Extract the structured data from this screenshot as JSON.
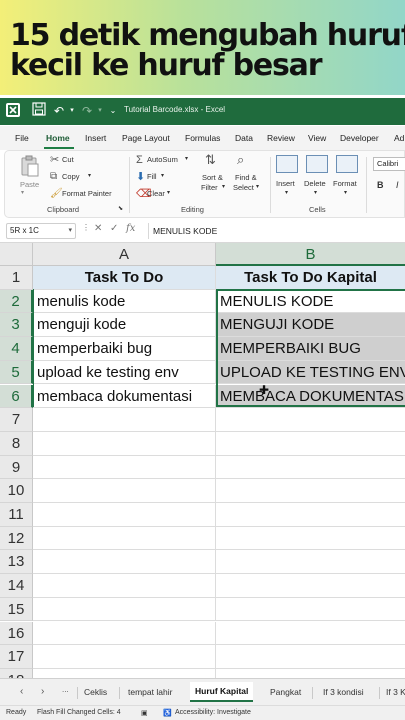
{
  "banner": {
    "line1": "15 detik mengubah huruf",
    "line2": "kecil ke huruf besar"
  },
  "titlebar": {
    "title": "Tutorial Barcode.xlsx  -  Excel"
  },
  "ribbon_tabs": [
    "File",
    "Home",
    "Insert",
    "Page Layout",
    "Formulas",
    "Data",
    "Review",
    "View",
    "Developer",
    "Ad"
  ],
  "ribbon": {
    "paste": "Paste",
    "cut": "Cut",
    "copy": "Copy",
    "format_painter": "Format Painter",
    "clipboard": "Clipboard",
    "autosum": "AutoSum",
    "fill": "Fill",
    "clear": "Clear",
    "sort_filter_1": "Sort &",
    "sort_filter_2": "Filter",
    "find_select_1": "Find &",
    "find_select_2": "Select",
    "editing": "Editing",
    "insert": "Insert",
    "delete": "Delete",
    "format": "Format",
    "cells": "Cells",
    "font_name": "Calibri",
    "bold": "B",
    "italic": "I"
  },
  "formula_bar": {
    "name_box": "5R x 1C",
    "formula": "MENULIS KODE"
  },
  "columns": [
    "A",
    "B"
  ],
  "rows": [
    "1",
    "2",
    "3",
    "4",
    "5",
    "6",
    "7",
    "8",
    "9",
    "10",
    "11",
    "12",
    "13",
    "14",
    "15",
    "16",
    "17",
    "18"
  ],
  "table": {
    "header_a": "Task To Do",
    "header_b": "Task To Do Kapital",
    "col_a": [
      "menulis kode",
      "menguji kode",
      "memperbaiki bug",
      "upload ke testing env",
      "membaca dokumentasi"
    ],
    "col_b": [
      "MENULIS KODE",
      "MENGUJI KODE",
      "MEMPERBAIKI BUG",
      "UPLOAD KE TESTING ENV",
      "MEMBACA DOKUMENTASI"
    ]
  },
  "sheets": {
    "more": "...",
    "tabs": [
      "Ceklis",
      "tempat lahir",
      "Huruf Kapital",
      "Pangkat",
      "If 3 kondisi",
      "If 3 K"
    ]
  },
  "status": {
    "ready": "Ready",
    "flash_fill": "Flash Fill Changed Cells: 4",
    "accessibility": "Accessibility: Investigate"
  },
  "colors": {
    "excel_green": "#217346",
    "header_fill": "#dde9f3",
    "flash_fill": "#cfcfcf"
  }
}
